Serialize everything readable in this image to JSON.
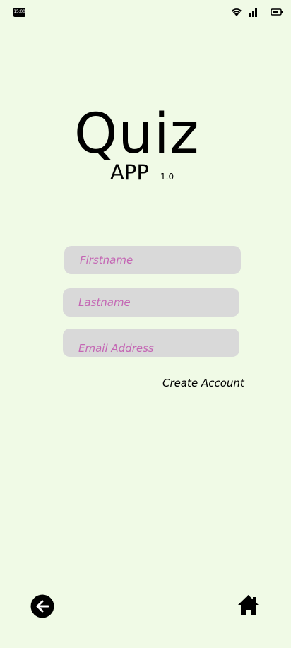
{
  "status_bar": {
    "time": "15:00",
    "icons": [
      "wifi-icon",
      "signal-icon",
      "battery-icon"
    ]
  },
  "app": {
    "title": "Quiz",
    "subtitle": "APP",
    "version": "1.0"
  },
  "form": {
    "firstname_placeholder": "Firstname",
    "lastname_placeholder": "Lastname",
    "email_placeholder": "Email Address",
    "create_account_label": "Create Account"
  },
  "nav": {
    "back_icon": "arrow-left-circle-icon",
    "home_icon": "home-icon"
  },
  "colors": {
    "background": "#f0fae6",
    "field_background": "#d9d9d9",
    "placeholder": "#c466b4",
    "text": "#000000"
  }
}
